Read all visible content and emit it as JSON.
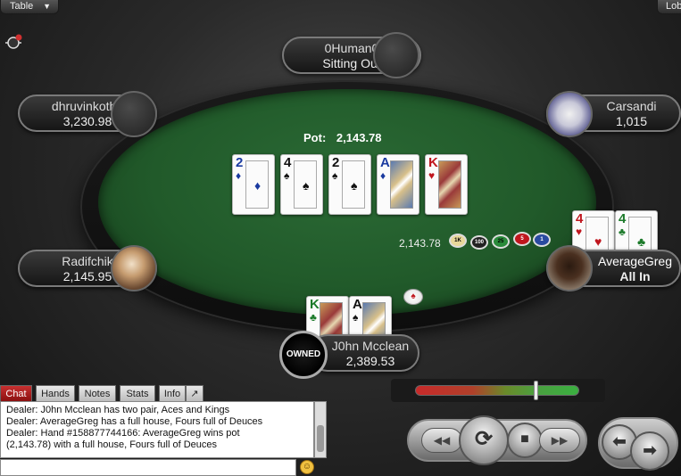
{
  "menus": {
    "table": "Table",
    "lobby": "Lobby"
  },
  "pot": {
    "label": "Pot:",
    "amount": "2,143.78"
  },
  "board": [
    {
      "rank": "2",
      "suit": "♦",
      "color": "blue"
    },
    {
      "rank": "4",
      "suit": "♠",
      "color": "black"
    },
    {
      "rank": "2",
      "suit": "♠",
      "color": "black"
    },
    {
      "rank": "A",
      "suit": "♦",
      "color": "blue"
    },
    {
      "rank": "K",
      "suit": "♥",
      "color": "red"
    }
  ],
  "players": {
    "top": {
      "name": "0Human0",
      "status": "Sitting Out"
    },
    "left_top": {
      "name": "dhruvinkotha",
      "stack": "3,230.98"
    },
    "right_top": {
      "name": "Carsandi",
      "stack": "1,015"
    },
    "left_mid": {
      "name": "Radifchik",
      "stack": "2,145.95"
    },
    "right_mid": {
      "name": "AverageGreg",
      "status": "All In",
      "cards": [
        {
          "rank": "4",
          "suit": "♥",
          "color": "red"
        },
        {
          "rank": "4",
          "suit": "♣",
          "color": "green"
        }
      ]
    },
    "hero": {
      "name": "J0hn Mcclean",
      "stack": "2,389.53",
      "badge": "OWNED",
      "cards": [
        {
          "rank": "K",
          "suit": "♣",
          "color": "green"
        },
        {
          "rank": "A",
          "suit": "♠",
          "color": "black"
        }
      ]
    }
  },
  "chips": {
    "amount": "2,143.78",
    "labels": [
      "1K",
      "100",
      "25",
      "5",
      "1"
    ],
    "colors": [
      "#e8d89a",
      "#222222",
      "#2a8a3a",
      "#c0161e",
      "#2a4aa0"
    ]
  },
  "chat": {
    "tabs": [
      "Chat",
      "Hands",
      "Notes",
      "Stats",
      "Info",
      "↗"
    ],
    "lines": [
      "Dealer: J0hn Mcclean has two pair, Aces and Kings",
      "Dealer: AverageGreg has a full house, Fours full of Deuces",
      "Dealer: Hand #158877744166: AverageGreg wins pot",
      "(2,143.78) with a full house, Fours full of Deuces"
    ],
    "input_placeholder": ""
  },
  "controls": {
    "rewind": "◀◀",
    "replay": "⟳",
    "stop": "■",
    "forward": "▶▶",
    "back": "⬅",
    "next": "➡"
  },
  "dealer_button": "♠"
}
